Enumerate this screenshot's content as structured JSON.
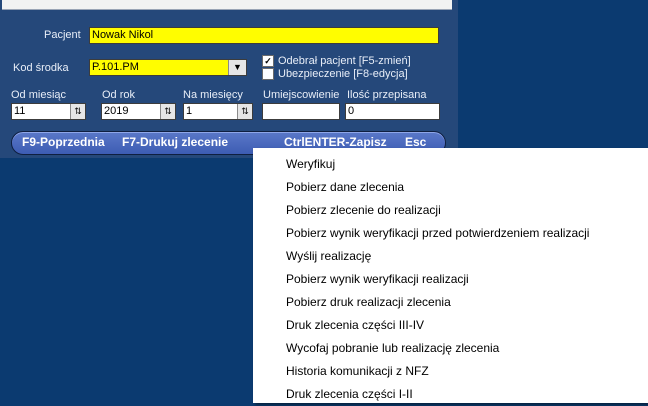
{
  "form": {
    "patient_label": "Pacjent",
    "patient_value": "Nowak Nikol",
    "drug_code_label": "Kod środka",
    "drug_code_value": "P.101.PM",
    "checkbox_received_label": "Odebrał pacjent  [F5-zmień]",
    "checkbox_received_checked": true,
    "checkbox_insurance_label": "Ubezpieczenie [F8-edycja]",
    "checkbox_insurance_checked": false,
    "from_month_label": "Od miesiąc",
    "from_month_value": "11",
    "from_year_label": "Od rok",
    "from_year_value": "2019",
    "months_label": "Na miesięcy",
    "months_value": "1",
    "location_label": "Umiejscowienie",
    "location_value": "",
    "quantity_label": "Ilość przepisana",
    "quantity_value": "0"
  },
  "shortcuts": {
    "prev": "F9-Poprzednia",
    "print": "F7-Drukuj zlecenie",
    "save": "CtrlENTER-Zapisz",
    "esc": "Esc"
  },
  "menu": {
    "items": [
      "Weryfikuj",
      "Pobierz dane zlecenia",
      "Pobierz zlecenie do realizacji",
      "Pobierz wynik weryfikacji  przed potwierdzeniem realizacji",
      "Wyślij realizację",
      "Pobierz wynik weryfikacji realizacji",
      "Pobierz druk realizacji zlecenia",
      "Druk zlecenia części III-IV",
      "Wycofaj pobranie lub realizację zlecenia",
      "Historia komunikacji z NFZ",
      "Druk zlecenia części I-II"
    ]
  },
  "colors": {
    "background": "#0b3a70",
    "panel": "#25487a",
    "highlight_field": "#fffd00",
    "shortcut_bar": "#4a68bd"
  },
  "icons": {
    "combo_arrow": "chevron-down-icon",
    "spin": "spin-arrows-icon",
    "check": "checkmark-icon"
  }
}
